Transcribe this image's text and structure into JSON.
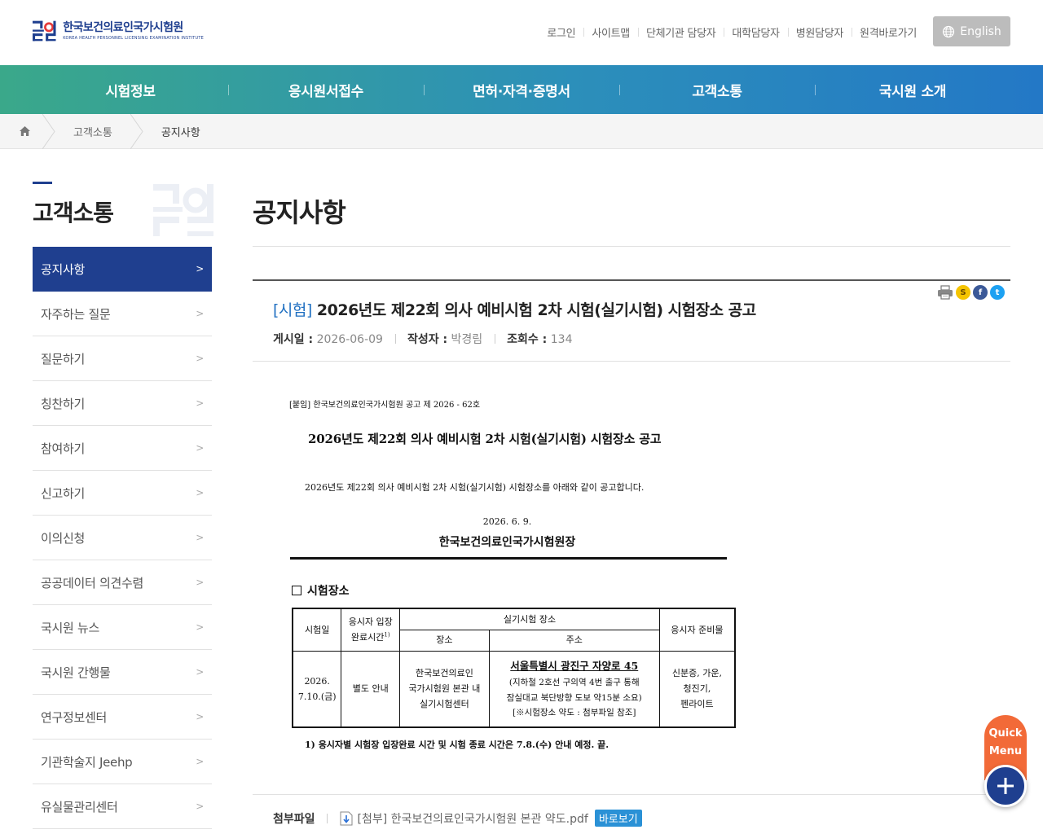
{
  "header": {
    "logo": {
      "name_kr": "한국보건의료인국가시험원",
      "name_en": "KOREA HEALTH PERSONNEL LICENSING EXAMINATION INSTITUTE"
    },
    "util_links": [
      "로그인",
      "사이트맵",
      "단체기관 담당자",
      "대학담당자",
      "병원담당자",
      "원격바로가기"
    ],
    "english_label": "English"
  },
  "gnb": [
    "시험정보",
    "응시원서접수",
    "면허·자격·증명서",
    "고객소통",
    "국시원 소개"
  ],
  "breadcrumb": [
    "고객소통",
    "공지사항"
  ],
  "lnb": {
    "title": "고객소통",
    "items": [
      {
        "label": "공지사항",
        "active": true
      },
      {
        "label": "자주하는 질문"
      },
      {
        "label": "질문하기"
      },
      {
        "label": "칭찬하기"
      },
      {
        "label": "참여하기"
      },
      {
        "label": "신고하기"
      },
      {
        "label": "이의신청"
      },
      {
        "label": "공공데이터 의견수렴"
      },
      {
        "label": "국시원 뉴스"
      },
      {
        "label": "국시원 간행물"
      },
      {
        "label": "연구정보센터"
      },
      {
        "label": "기관학술지 Jeehp"
      },
      {
        "label": "유실물관리센터"
      }
    ]
  },
  "page": {
    "title": "공지사항"
  },
  "post": {
    "category": "[시험]",
    "title": "2026년도 제22회 의사 예비시험 2차 시험(실기시험) 시험장소 공고",
    "meta": {
      "date_label": "게시일 :",
      "date": "2026-06-09",
      "author_label": "작성자 :",
      "author": "박경림",
      "views_label": "조회수 :",
      "views": "134"
    }
  },
  "notice": {
    "ref": "[붙임] 한국보건의료인국가시험원 공고 제 2026 - 62호",
    "heading": "2026년도 제22회 의사 예비시험 2차 시험(실기시험) 시험장소 공고",
    "body": "2026년도 제22회 의사 예비시험 2차 시험(실기시험) 시험장소를 아래와 같이 공고합니다.",
    "date": "2026. 6. 9.",
    "org": "한국보건의료인국가시험원장",
    "section": "시험장소",
    "table": {
      "h_date": "시험일",
      "h_entry_1": "응시자 입장",
      "h_entry_2": "완료시간",
      "h_entry_sup": "1)",
      "h_venue": "실기시험 장소",
      "h_place": "장소",
      "h_addr": "주소",
      "h_prep": "응시자 준비물",
      "r_date_1": "2026.",
      "r_date_2": "7.10.(금)",
      "r_entry": "별도 안내",
      "r_place_1": "한국보건의료인",
      "r_place_2": "국가시험원 본관 내",
      "r_place_3": "실기시험센터",
      "r_addr_main": "서울특별시 광진구 자양로 45",
      "r_addr_2": "(지하철 2호선 구의역 4번 출구 통해",
      "r_addr_3": "잠실대교 북단방향 도보 약15분 소요)",
      "r_addr_4": "[※시험장소 약도 : 첨부파일 참조]",
      "r_prep_1": "신분증, 가운,",
      "r_prep_2": "청진기,",
      "r_prep_3": "펜라이트"
    },
    "footnote": "1) 응시자별 시험장 입장완료 시간 및 시험 종료 시간은 7.8.(수) 안내 예정.   끝."
  },
  "attachment": {
    "label": "첨부파일",
    "file": "[첨부] 한국보건의료인국가시험원 본관 약도.pdf",
    "view": "바로보기"
  },
  "quick": {
    "line1": "Quick",
    "line2": "Menu"
  },
  "colors": {
    "primary": "#1f3f8f",
    "category": "#1f6fc1",
    "quick": "#f26a38"
  }
}
